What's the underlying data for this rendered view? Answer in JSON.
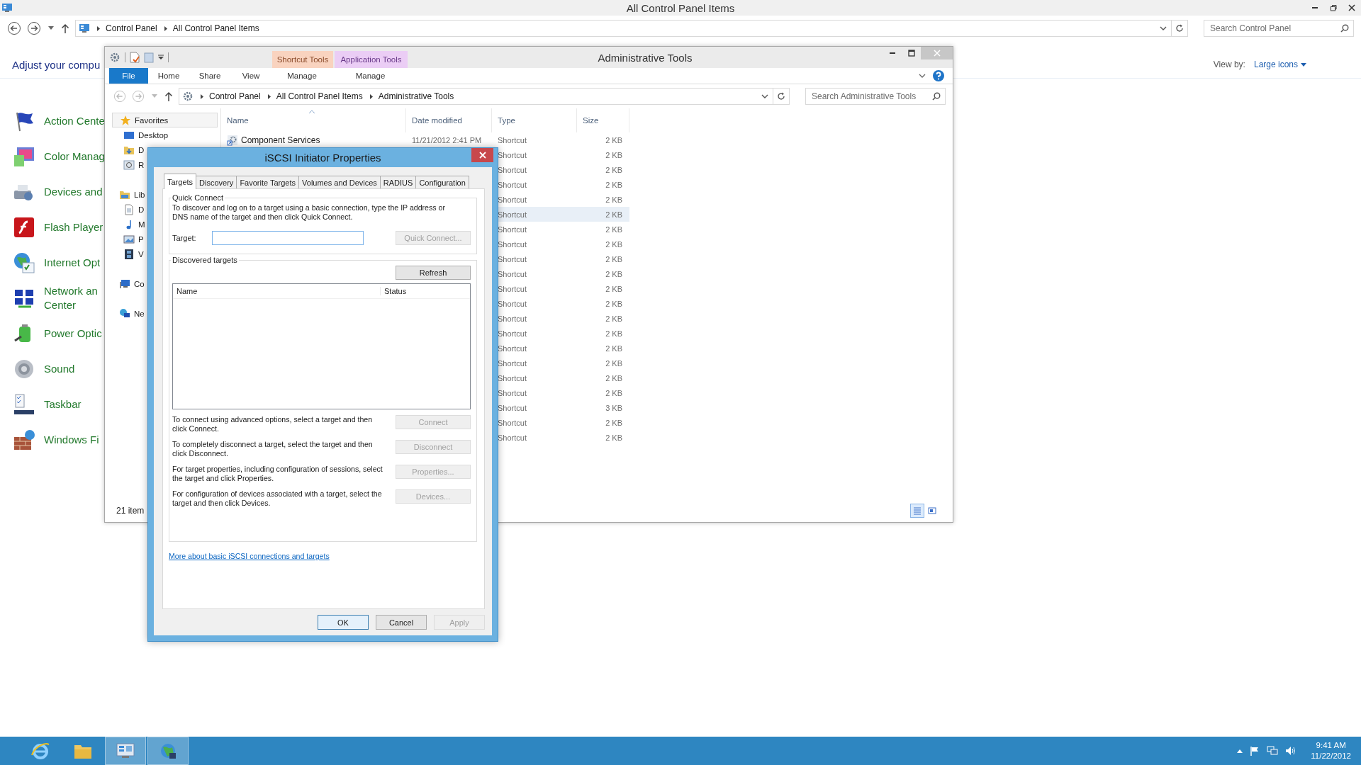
{
  "control_panel": {
    "title": "All Control Panel Items",
    "breadcrumb": [
      "Control Panel",
      "All Control Panel Items"
    ],
    "search": {
      "placeholder": "Search Control Panel"
    },
    "heading": "Adjust your compu",
    "view_by": {
      "label": "View by:",
      "value": "Large icons"
    },
    "items": [
      {
        "lines": [
          "Action Cente"
        ],
        "kind": "flag"
      },
      {
        "lines": [
          "Color Manag"
        ],
        "kind": "color"
      },
      {
        "lines": [
          "Devices and"
        ],
        "kind": "devices"
      },
      {
        "lines": [
          "Flash Player"
        ],
        "kind": "flash"
      },
      {
        "lines": [
          "Internet Opt"
        ],
        "kind": "internet"
      },
      {
        "lines": [
          "Network an",
          "Center"
        ],
        "kind": "network"
      },
      {
        "lines": [
          "Power Optic"
        ],
        "kind": "power"
      },
      {
        "lines": [
          "Sound"
        ],
        "kind": "sound"
      },
      {
        "lines": [
          "Taskbar"
        ],
        "kind": "taskbar"
      },
      {
        "lines": [
          "Windows Fi"
        ],
        "kind": "firewall"
      }
    ]
  },
  "admin": {
    "title": "Administrative Tools",
    "context_tabs": [
      {
        "label": "Shortcut Tools",
        "color": "#f9d3bf"
      },
      {
        "label": "Application Tools",
        "color": "#ebcdf5"
      }
    ],
    "ribbon_tabs": [
      {
        "label": "File",
        "kind": "file"
      },
      {
        "label": "Home",
        "kind": "tab"
      },
      {
        "label": "Share",
        "kind": "tab"
      },
      {
        "label": "View",
        "kind": "tab"
      },
      {
        "label": "Manage",
        "kind": "context"
      },
      {
        "label": "Manage",
        "kind": "context"
      }
    ],
    "breadcrumb": [
      "Control Panel",
      "All Control Panel Items",
      "Administrative Tools"
    ],
    "search": {
      "placeholder": "Search Administrative Tools"
    },
    "nav": [
      {
        "label": "Favorites",
        "kind": "star",
        "selected": true,
        "children": [
          {
            "label": "Desktop",
            "kind": "desktop",
            "selected": false
          },
          {
            "label": "D",
            "kind": "downloads",
            "selected": false
          },
          {
            "label": "R",
            "kind": "recent",
            "selected": false
          }
        ]
      },
      {
        "label": "Lib",
        "kind": "library",
        "selected": false,
        "children": [
          {
            "label": "D",
            "kind": "document",
            "selected": false
          },
          {
            "label": "M",
            "kind": "music",
            "selected": false
          },
          {
            "label": "P",
            "kind": "pictures",
            "selected": false
          },
          {
            "label": "V",
            "kind": "videos",
            "selected": false
          }
        ]
      },
      {
        "label": "Co",
        "kind": "computer",
        "selected": false
      },
      {
        "label": "Ne",
        "kind": "network",
        "selected": false
      }
    ],
    "columns": [
      "Name",
      "Date modified",
      "Type",
      "Size"
    ],
    "rows": [
      {
        "name": "Component Services",
        "date": "11/21/2012 2:41 PM",
        "type": "Shortcut",
        "size": "2 KB",
        "selected": false
      },
      {
        "type": "Shortcut",
        "size": "2 KB",
        "selected": false
      },
      {
        "type": "Shortcut",
        "size": "2 KB",
        "selected": false
      },
      {
        "type": "Shortcut",
        "size": "2 KB",
        "selected": false
      },
      {
        "type": "Shortcut",
        "size": "2 KB",
        "selected": false
      },
      {
        "type": "Shortcut",
        "size": "2 KB",
        "selected": true
      },
      {
        "type": "Shortcut",
        "size": "2 KB",
        "selected": false
      },
      {
        "type": "Shortcut",
        "size": "2 KB",
        "selected": false
      },
      {
        "type": "Shortcut",
        "size": "2 KB",
        "selected": false
      },
      {
        "type": "Shortcut",
        "size": "2 KB",
        "selected": false
      },
      {
        "type": "Shortcut",
        "size": "2 KB",
        "selected": false
      },
      {
        "type": "Shortcut",
        "size": "2 KB",
        "selected": false
      },
      {
        "type": "Shortcut",
        "size": "2 KB",
        "selected": false
      },
      {
        "type": "Shortcut",
        "size": "2 KB",
        "selected": false
      },
      {
        "type": "Shortcut",
        "size": "2 KB",
        "selected": false
      },
      {
        "type": "Shortcut",
        "size": "2 KB",
        "selected": false
      },
      {
        "type": "Shortcut",
        "size": "2 KB",
        "selected": false
      },
      {
        "type": "Shortcut",
        "size": "2 KB",
        "selected": false
      },
      {
        "type": "Shortcut",
        "size": "3 KB",
        "selected": false
      },
      {
        "type": "Shortcut",
        "size": "2 KB",
        "selected": false
      },
      {
        "type": "Shortcut",
        "size": "2 KB",
        "selected": false
      }
    ],
    "status": "21 item"
  },
  "dialog": {
    "title": "iSCSI Initiator Properties",
    "tabs": [
      {
        "label": "Targets",
        "selected": true
      },
      {
        "label": "Discovery",
        "selected": false
      },
      {
        "label": "Favorite Targets",
        "selected": false
      },
      {
        "label": "Volumes and Devices",
        "selected": false
      },
      {
        "label": "RADIUS",
        "selected": false
      },
      {
        "label": "Configuration",
        "selected": false
      }
    ],
    "quick_connect": {
      "legend": "Quick Connect",
      "text": "To discover and log on to a target using a basic connection, type the IP address or DNS name of the target and then click Quick Connect.",
      "target_label": "Target:",
      "button": {
        "label": "Quick Connect...",
        "disabled": true
      }
    },
    "discovered": {
      "legend": "Discovered targets",
      "refresh": {
        "label": "Refresh",
        "disabled": false
      },
      "columns": [
        "Name",
        "Status"
      ],
      "actions": [
        {
          "text": "To connect using advanced options, select a target and then click Connect.",
          "button": {
            "label": "Connect",
            "disabled": true
          }
        },
        {
          "text": "To completely disconnect a target, select the target and then click Disconnect.",
          "button": {
            "label": "Disconnect",
            "disabled": true
          }
        },
        {
          "text": "For target properties, including configuration of sessions, select the target and click Properties.",
          "button": {
            "label": "Properties...",
            "disabled": true
          }
        },
        {
          "text": "For configuration of devices associated with a target, select the target and then click Devices.",
          "button": {
            "label": "Devices...",
            "disabled": true
          }
        }
      ]
    },
    "link": "More about basic iSCSI connections and targets",
    "buttons": [
      {
        "label": "OK",
        "kind": "default",
        "disabled": false
      },
      {
        "label": "Cancel",
        "kind": "normal",
        "disabled": false
      },
      {
        "label": "Apply",
        "kind": "normal",
        "disabled": true
      }
    ]
  },
  "taskbar": {
    "apps": [
      {
        "kind": "ie",
        "active": false
      },
      {
        "kind": "explorer",
        "active": false
      },
      {
        "kind": "control-panel",
        "active": true
      },
      {
        "kind": "iscsi",
        "active": true
      }
    ],
    "time": "9:41 AM",
    "date": "11/22/2012"
  }
}
